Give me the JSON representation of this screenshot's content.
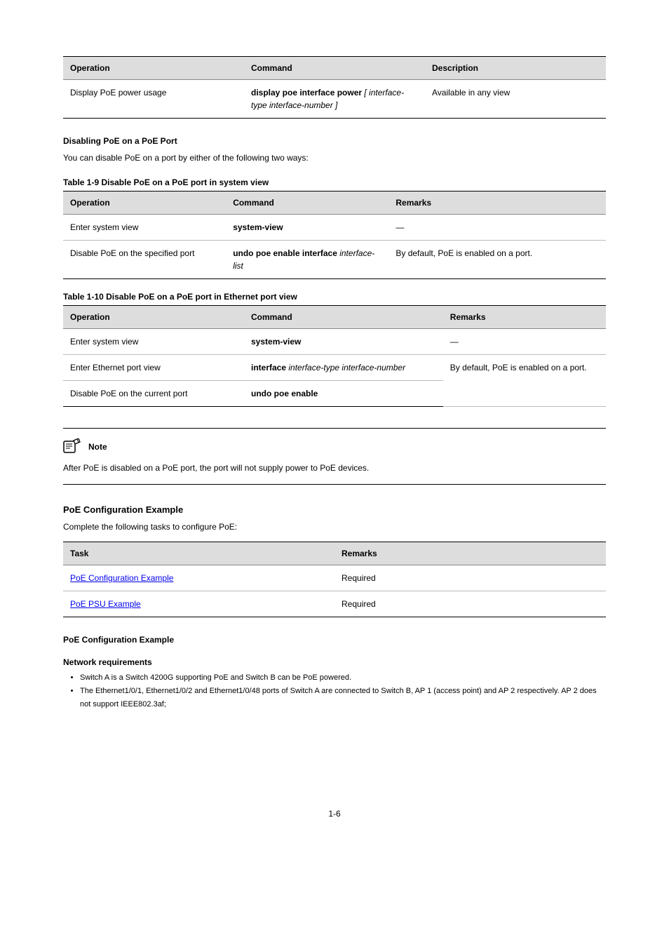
{
  "tables": {
    "t1": {
      "headers": [
        "Operation",
        "Command",
        "Description"
      ],
      "rows": [
        {
          "op": "Display PoE power usage",
          "cmd_pre": "display poe interface power",
          "cmd_arg": " [ interface-type interface-number ]",
          "desc_pre": "Available in any view"
        }
      ]
    }
  },
  "sections": {
    "disabling_title": "Disabling PoE on a PoE Port",
    "disabling_intro": "You can disable PoE on a port by either of the following two ways:",
    "t2_caption": "Table 1-9 Disable PoE on a PoE port in system view",
    "t2": {
      "headers": [
        "Operation",
        "Command",
        "Remarks"
      ],
      "rows": [
        {
          "op": "Enter system view",
          "cmd": "system-view",
          "desc": "—"
        },
        {
          "op": "Disable PoE on the specified port",
          "cmd_pre": "undo poe enable interface ",
          "cmd_arg": "interface-list",
          "desc": "By default, PoE is enabled on a port."
        }
      ]
    },
    "t3_caption": "Table 1-10 Disable PoE on a PoE port in Ethernet port view",
    "t3": {
      "headers": [
        "Operation",
        "Command",
        "Remarks"
      ],
      "rows": [
        {
          "op": "Enter system view",
          "cmd": "system-view",
          "desc": "—"
        },
        {
          "op": "Enter Ethernet port view",
          "cmd_pre": "interface ",
          "cmd_arg1": "interface-type interface-number",
          "cmd_tail": "",
          "desc": "By default, PoE is enabled on a port."
        }
      ],
      "row3": {
        "op": "Disable PoE on the current port",
        "cmd": "undo poe enable",
        "desc": ""
      }
    },
    "note_label": "Note",
    "note_text": "After PoE is disabled on a PoE port, the port will not supply power to PoE devices.",
    "config_title": "PoE Configuration Example",
    "t4_caption": "Complete the following tasks to configure PoE:",
    "t4": {
      "headers": [
        "Task",
        "Remarks"
      ],
      "rows": [
        {
          "task": "PoE Configuration Example",
          "remarks": "Required"
        },
        {
          "task": "PoE PSU Example",
          "remarks": "Required"
        }
      ]
    },
    "example_title": "PoE Configuration Example",
    "network_req_title": "Network requirements",
    "bullets": [
      "Switch A is a Switch 4200G supporting PoE and Switch B can be PoE powered.",
      "The Ethernet1/0/1, Ethernet1/0/2 and Ethernet1/0/48 ports of Switch A are connected to Switch B, AP 1 (access point) and AP 2 respectively. AP 2 does not support IEEE802.3af;"
    ]
  },
  "footer": "1-6"
}
